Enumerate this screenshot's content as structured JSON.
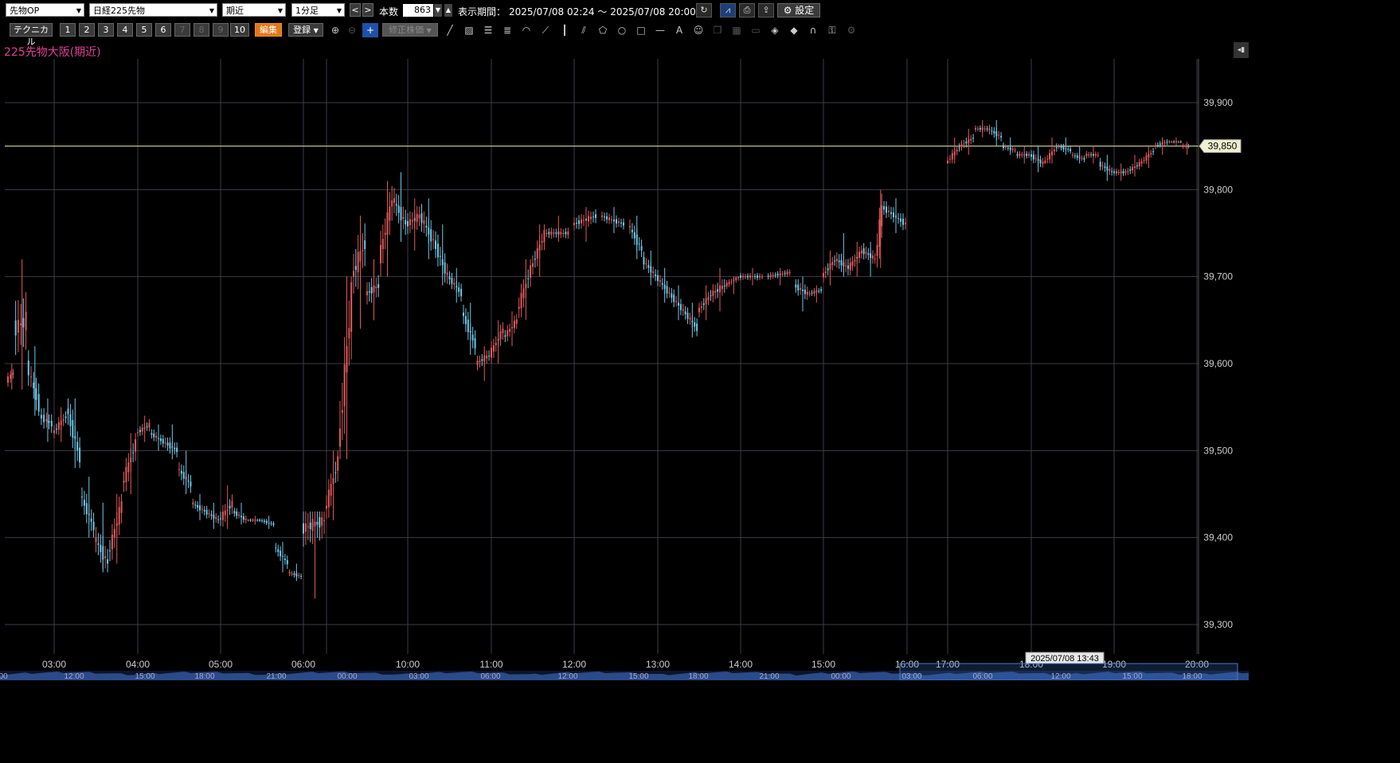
{
  "toolbar": {
    "market_select": "先物OP",
    "symbol_select": "日経225先物",
    "contract_select": "期近",
    "interval_select": "1分足",
    "prev_label": "<",
    "next_label": ">",
    "count_label": "本数",
    "count_value": "863",
    "period_label": "表示期間：",
    "period_value": "2025/07/08 02:24 ～ 2025/07/08 20:00",
    "settings_label": "設定"
  },
  "toolbar2": {
    "technical_label": "テクニカル",
    "slots": [
      "1",
      "2",
      "3",
      "4",
      "5",
      "6",
      "7",
      "8",
      "9",
      "10"
    ],
    "edit_label": "編集",
    "register_label": "登録",
    "adjusted_price_label": "修正株価"
  },
  "chart_title": "225先物大阪(期近)",
  "colors": {
    "up": "#e05a5a",
    "down": "#6fc8e8",
    "grid": "#3c3c4a",
    "last_price_line": "#e8e8b0",
    "title": "#e0409a"
  },
  "chart_data": {
    "type": "candlestick",
    "title": "225先物大阪(期近)",
    "ylim": [
      39280,
      39920
    ],
    "y_ticks": [
      "39,300",
      "39,400",
      "39,500",
      "39,600",
      "39,700",
      "39,800",
      "39,900"
    ],
    "x_ticks": [
      "03:00",
      "04:00",
      "05:00",
      "06:00",
      "10:00",
      "11:00",
      "12:00",
      "13:00",
      "14:00",
      "15:00",
      "16:00",
      "17:00",
      "18:00",
      "19:00",
      "20:00"
    ],
    "overview_ticks": [
      "0:00",
      "12:00",
      "15:00",
      "18:00",
      "21:00",
      "00:00",
      "03:00",
      "06:00",
      "12:00",
      "15:00",
      "18:00",
      "21:00",
      "00:00",
      "03:00",
      "06:00",
      "12:00",
      "15:00",
      "18:00"
    ],
    "last_price": "39,850",
    "crosshair_time": "2025/07/08 13:43",
    "series": [
      {
        "x": "02:24",
        "values": [
          39580,
          39600,
          39570,
          39590
        ]
      },
      {
        "x": "02:30",
        "values": [
          39640,
          39720,
          39570,
          39650
        ]
      },
      {
        "x": "02:40",
        "values": [
          39600,
          39620,
          39540,
          39550
        ]
      },
      {
        "x": "02:50",
        "values": [
          39540,
          39560,
          39510,
          39530
        ]
      },
      {
        "x": "03:00",
        "values": [
          39520,
          39550,
          39510,
          39540
        ]
      },
      {
        "x": "03:10",
        "values": [
          39550,
          39560,
          39480,
          39490
        ]
      },
      {
        "x": "03:20",
        "values": [
          39450,
          39470,
          39400,
          39410
        ]
      },
      {
        "x": "03:30",
        "values": [
          39400,
          39440,
          39360,
          39370
        ]
      },
      {
        "x": "03:40",
        "values": [
          39380,
          39450,
          39370,
          39440
        ]
      },
      {
        "x": "03:50",
        "values": [
          39460,
          39520,
          39450,
          39510
        ]
      },
      {
        "x": "04:00",
        "values": [
          39520,
          39540,
          39510,
          39530
        ]
      },
      {
        "x": "04:10",
        "values": [
          39520,
          39530,
          39500,
          39510
        ]
      },
      {
        "x": "04:20",
        "values": [
          39510,
          39530,
          39490,
          39500
        ]
      },
      {
        "x": "04:30",
        "values": [
          39480,
          39500,
          39450,
          39460
        ]
      },
      {
        "x": "04:40",
        "values": [
          39440,
          39450,
          39420,
          39430
        ]
      },
      {
        "x": "04:50",
        "values": [
          39430,
          39440,
          39410,
          39420
        ]
      },
      {
        "x": "05:00",
        "values": [
          39420,
          39460,
          39410,
          39440
        ]
      },
      {
        "x": "05:10",
        "values": [
          39430,
          39440,
          39415,
          39420
        ]
      },
      {
        "x": "05:20",
        "values": [
          39420,
          39425,
          39415,
          39420
        ]
      },
      {
        "x": "05:30",
        "values": [
          39420,
          39425,
          39410,
          39415
        ]
      },
      {
        "x": "05:40",
        "values": [
          39390,
          39395,
          39360,
          39370
        ]
      },
      {
        "x": "05:50",
        "values": [
          39360,
          39370,
          39350,
          39355
        ]
      },
      {
        "x": "06:00",
        "values": [
          39410,
          39430,
          39330,
          39420
        ]
      },
      {
        "x": "09:00",
        "values": [
          39430,
          39500,
          39420,
          39490
        ]
      },
      {
        "x": "09:10",
        "values": [
          39500,
          39700,
          39490,
          39680
        ]
      },
      {
        "x": "09:20",
        "values": [
          39700,
          39770,
          39640,
          39740
        ]
      },
      {
        "x": "09:30",
        "values": [
          39680,
          39720,
          39650,
          39690
        ]
      },
      {
        "x": "09:40",
        "values": [
          39720,
          39810,
          39700,
          39790
        ]
      },
      {
        "x": "09:50",
        "values": [
          39790,
          39820,
          39740,
          39760
        ]
      },
      {
        "x": "10:00",
        "values": [
          39760,
          39790,
          39730,
          39770
        ]
      },
      {
        "x": "10:10",
        "values": [
          39770,
          39790,
          39720,
          39740
        ]
      },
      {
        "x": "10:20",
        "values": [
          39740,
          39760,
          39690,
          39700
        ]
      },
      {
        "x": "10:30",
        "values": [
          39700,
          39710,
          39670,
          39680
        ]
      },
      {
        "x": "10:40",
        "values": [
          39660,
          39670,
          39610,
          39620
        ]
      },
      {
        "x": "10:50",
        "values": [
          39600,
          39620,
          39580,
          39610
        ]
      },
      {
        "x": "11:00",
        "values": [
          39610,
          39650,
          39600,
          39640
        ]
      },
      {
        "x": "11:10",
        "values": [
          39630,
          39660,
          39620,
          39650
        ]
      },
      {
        "x": "11:20",
        "values": [
          39660,
          39720,
          39650,
          39710
        ]
      },
      {
        "x": "11:30",
        "values": [
          39710,
          39760,
          39700,
          39750
        ]
      },
      {
        "x": "11:40",
        "values": [
          39750,
          39770,
          39740,
          39750
        ]
      },
      {
        "x": "12:00",
        "values": [
          39760,
          39780,
          39740,
          39770
        ]
      },
      {
        "x": "12:20",
        "values": [
          39770,
          39780,
          39750,
          39760
        ]
      },
      {
        "x": "12:40",
        "values": [
          39760,
          39770,
          39720,
          39730
        ]
      },
      {
        "x": "12:50",
        "values": [
          39720,
          39730,
          39690,
          39700
        ]
      },
      {
        "x": "13:00",
        "values": [
          39700,
          39710,
          39670,
          39680
        ]
      },
      {
        "x": "13:10",
        "values": [
          39680,
          39690,
          39650,
          39660
        ]
      },
      {
        "x": "13:20",
        "values": [
          39660,
          39670,
          39630,
          39640
        ]
      },
      {
        "x": "13:30",
        "values": [
          39660,
          39690,
          39650,
          39680
        ]
      },
      {
        "x": "13:40",
        "values": [
          39680,
          39710,
          39660,
          39690
        ]
      },
      {
        "x": "13:50",
        "values": [
          39690,
          39700,
          39680,
          39700
        ]
      },
      {
        "x": "14:00",
        "values": [
          39700,
          39710,
          39690,
          39700
        ]
      },
      {
        "x": "14:20",
        "values": [
          39700,
          39710,
          39690,
          39705
        ]
      },
      {
        "x": "14:40",
        "values": [
          39690,
          39700,
          39660,
          39680
        ]
      },
      {
        "x": "14:50",
        "values": [
          39680,
          39690,
          39670,
          39685
        ]
      },
      {
        "x": "15:00",
        "values": [
          39700,
          39730,
          39690,
          39720
        ]
      },
      {
        "x": "15:10",
        "values": [
          39720,
          39750,
          39700,
          39710
        ]
      },
      {
        "x": "15:20",
        "values": [
          39710,
          39740,
          39700,
          39730
        ]
      },
      {
        "x": "15:30",
        "values": [
          39730,
          39740,
          39700,
          39720
        ]
      },
      {
        "x": "15:40",
        "values": [
          39720,
          39800,
          39710,
          39780
        ]
      },
      {
        "x": "15:45",
        "values": [
          39780,
          39790,
          39750,
          39760
        ]
      },
      {
        "x": "17:00",
        "values": [
          39830,
          39860,
          39830,
          39850
        ]
      },
      {
        "x": "17:10",
        "values": [
          39850,
          39870,
          39840,
          39860
        ]
      },
      {
        "x": "17:20",
        "values": [
          39870,
          39880,
          39860,
          39870
        ]
      },
      {
        "x": "17:30",
        "values": [
          39870,
          39880,
          39850,
          39860
        ]
      },
      {
        "x": "17:40",
        "values": [
          39850,
          39860,
          39840,
          39845
        ]
      },
      {
        "x": "17:50",
        "values": [
          39840,
          39850,
          39830,
          39840
        ]
      },
      {
        "x": "18:00",
        "values": [
          39840,
          39850,
          39820,
          39830
        ]
      },
      {
        "x": "18:10",
        "values": [
          39830,
          39860,
          39830,
          39850
        ]
      },
      {
        "x": "18:20",
        "values": [
          39850,
          39860,
          39840,
          39845
        ]
      },
      {
        "x": "18:30",
        "values": [
          39840,
          39850,
          39830,
          39835
        ]
      },
      {
        "x": "18:40",
        "values": [
          39840,
          39850,
          39830,
          39840
        ]
      },
      {
        "x": "18:50",
        "values": [
          39830,
          39840,
          39810,
          39820
        ]
      },
      {
        "x": "19:00",
        "values": [
          39820,
          39830,
          39810,
          39820
        ]
      },
      {
        "x": "19:10",
        "values": [
          39820,
          39840,
          39815,
          39830
        ]
      },
      {
        "x": "19:20",
        "values": [
          39830,
          39850,
          39825,
          39845
        ]
      },
      {
        "x": "19:30",
        "values": [
          39850,
          39860,
          39840,
          39855
        ]
      },
      {
        "x": "19:40",
        "values": [
          39855,
          39860,
          39850,
          39855
        ]
      },
      {
        "x": "19:50",
        "values": [
          39850,
          39855,
          39840,
          39850
        ]
      }
    ]
  }
}
